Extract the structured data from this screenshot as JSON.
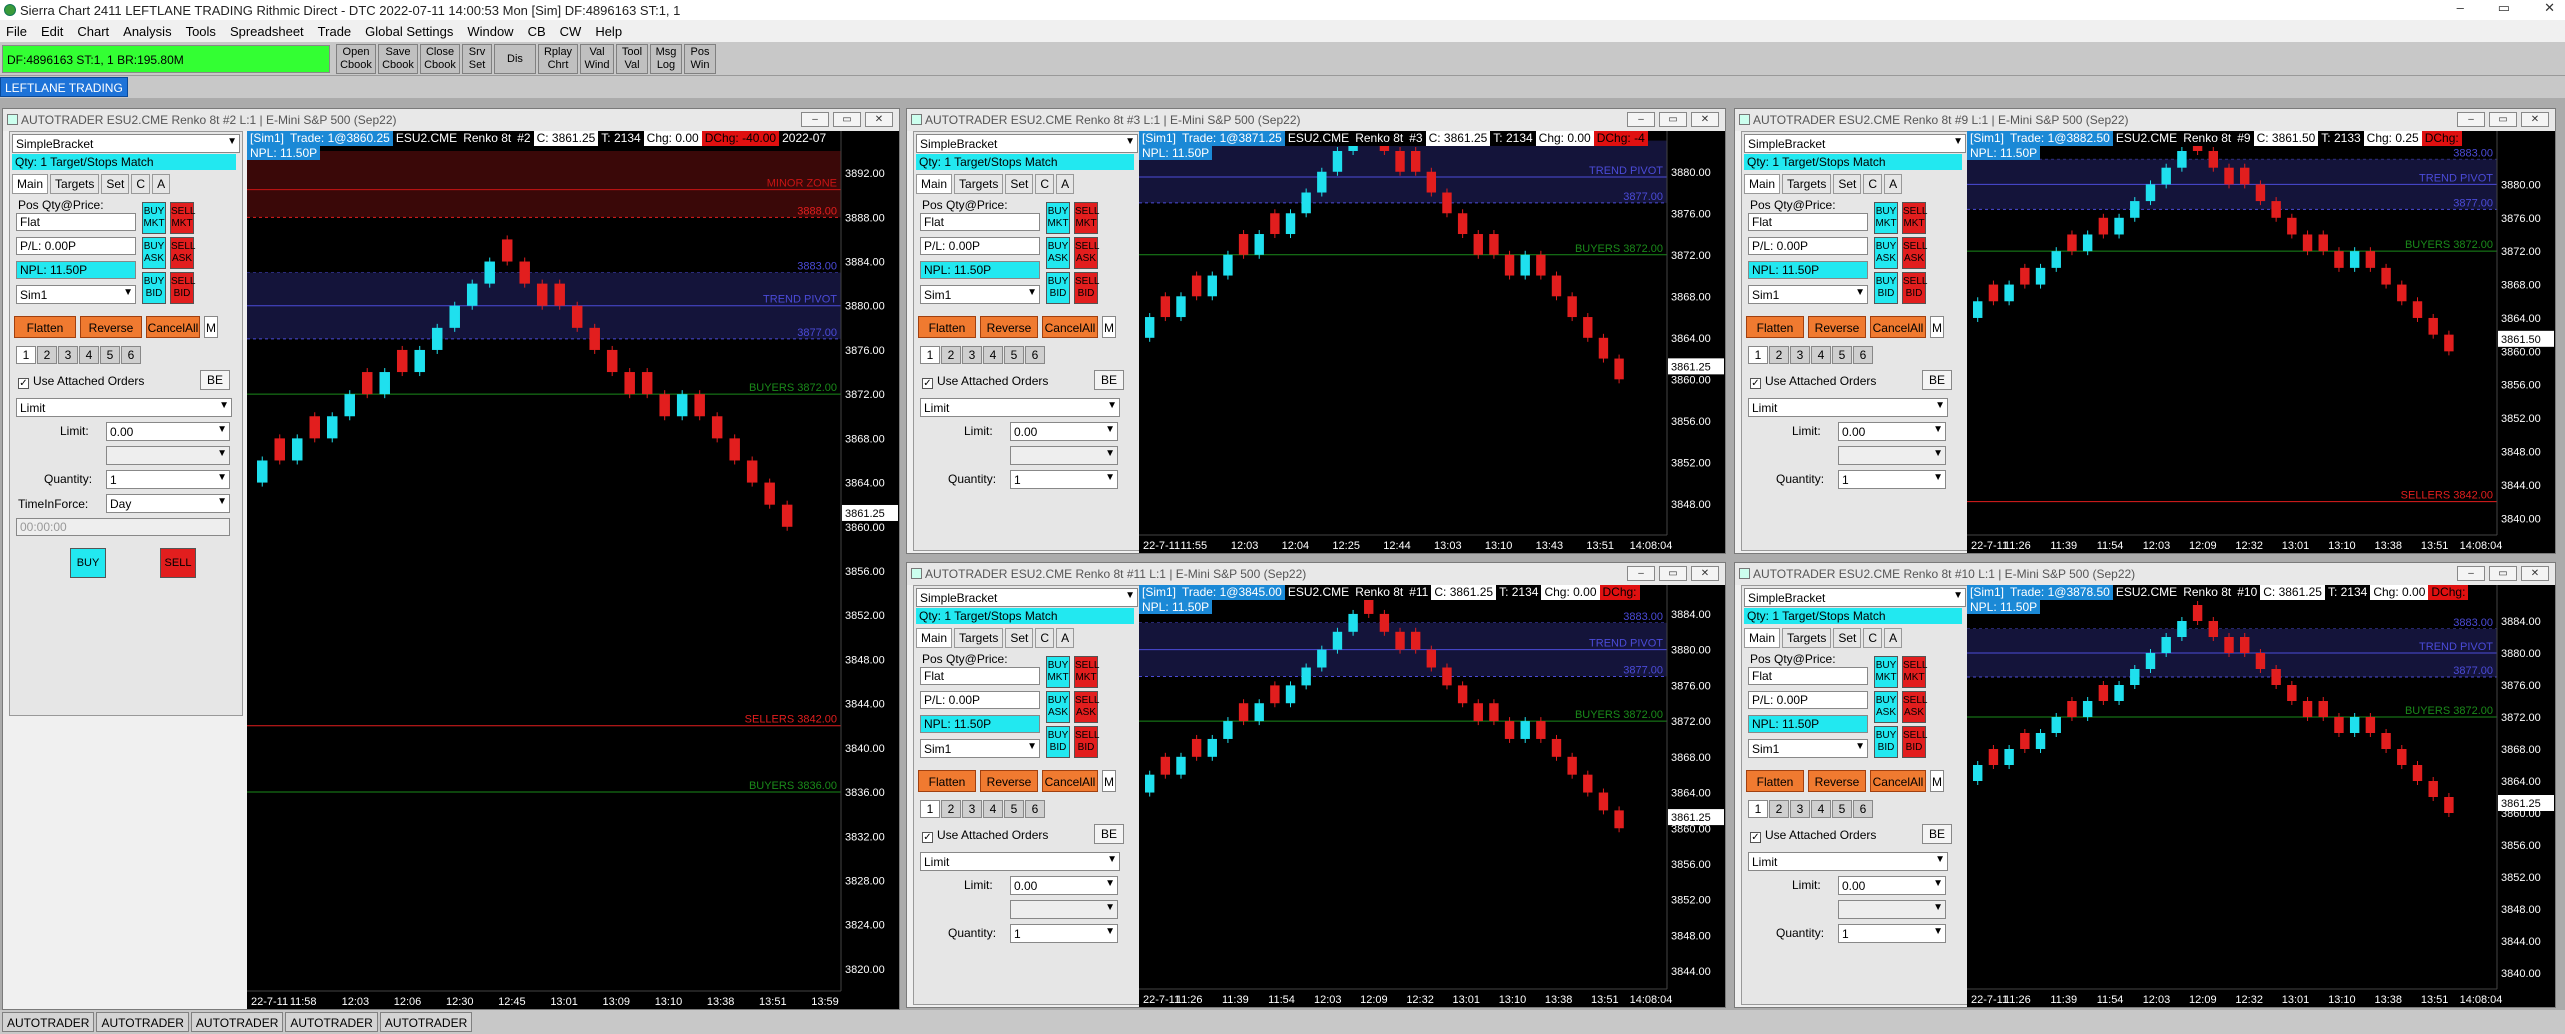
{
  "app": {
    "title": "Sierra Chart 2411 LEFTLANE TRADING  Rithmic Direct - DTC 2022-07-11  14:00:53 Mon [Sim]  DF:4896163  ST:1, 1",
    "window_controls": [
      "–",
      "▭",
      "✕"
    ]
  },
  "menu": [
    "File",
    "Edit",
    "Chart",
    "Analysis",
    "Tools",
    "Spreadsheet",
    "Trade",
    "Global Settings",
    "Window",
    "CB",
    "CW",
    "Help"
  ],
  "toolbar": {
    "status": "DF:4896163  ST:1, 1   BR:195.80M",
    "buttons": [
      {
        "l1": "Open",
        "l2": "Cbook"
      },
      {
        "l1": "Save",
        "l2": "Cbook"
      },
      {
        "l1": "Close",
        "l2": "Cbook"
      },
      {
        "l1": "Srv",
        "l2": "Set"
      },
      {
        "l1": "Dis",
        "l2": ""
      },
      {
        "l1": "Rplay",
        "l2": "Chrt"
      },
      {
        "l1": "Val",
        "l2": "Wind"
      },
      {
        "l1": "Tool",
        "l2": "Val"
      },
      {
        "l1": "Msg",
        "l2": "Log"
      },
      {
        "l1": "Pos",
        "l2": "Win"
      }
    ]
  },
  "chartbook_tab": "LEFTLANE TRADING",
  "bottom_tabs": [
    "AUTOTRADER",
    "AUTOTRADER",
    "AUTOTRADER",
    "AUTOTRADER",
    "AUTOTRADER"
  ],
  "colors": {
    "up": "#1fe0ee",
    "down": "#e21e1e",
    "trend_pivot": "#4b4bd8",
    "buyers": "#1a8a1a",
    "sellers": "#e21e1e",
    "minor_zone": "#c81414"
  },
  "dom": {
    "strategy": "SimpleBracket",
    "qty_label": "Qty: 1 Target/Stops Match",
    "tabs": [
      "Main",
      "Targets",
      "Set",
      "C",
      "A"
    ],
    "pos_label": "Pos Qty@Price:",
    "pos_value": "Flat",
    "pl_value": "P/L: 0.00P",
    "npl_value": "NPL: 11.50P",
    "account": "Sim1",
    "buy_mkt": "BUY\nMKT",
    "sell_mkt": "SELL\nMKT",
    "buy_ask": "BUY\nASK",
    "sell_ask": "SELL\nASK",
    "buy_bid": "BUY\nBID",
    "sell_bid": "SELL\nBID",
    "flatten": "Flatten",
    "reverse": "Reverse",
    "cancel_all": "CancelAll",
    "m": "M",
    "num_tabs": [
      "1",
      "2",
      "3",
      "4",
      "5",
      "6"
    ],
    "use_attached": "Use Attached Orders",
    "be": "BE",
    "order_type": "Limit",
    "limit_label": "Limit:",
    "limit_value": "0.00",
    "quantity_label": "Quantity:",
    "quantity_value": "1",
    "tif_label": "TimeInForce:",
    "tif_value": "Day",
    "time_value": "00:00:00",
    "buy": "BUY",
    "sell": "SELL"
  },
  "windows": [
    {
      "id": "w2",
      "title": "AUTOTRADER ESU2.CME  Renko 8t  #2 L:1 | E-Mini S&P 500 (Sep22)",
      "info": {
        "sim": "[Sim1]",
        "trade": "Trade: 1@3860.25",
        "symbol": "ESU2.CME",
        "bars": "Renko 8t",
        "num": "#2",
        "close": "C: 3861.25",
        "ticks": "T: 2134",
        "chg": "Chg: 0.00",
        "dchg": "DChg: -40.00",
        "date": "2022-07"
      },
      "npl": "NPL: 11.50P",
      "ylim": [
        3818,
        3894
      ],
      "yticks": [
        "3892.00",
        "3888.00",
        "3884.00",
        "3880.00",
        "3876.00",
        "3872.00",
        "3868.00",
        "3864.00",
        "3860.00",
        "3856.00",
        "3852.00",
        "3848.00",
        "3844.00",
        "3840.00",
        "3836.00",
        "3832.00",
        "3828.00",
        "3824.00",
        "3820.00"
      ],
      "price": "3861.25",
      "xlabels": [
        "22-7-11",
        "11:58",
        "12:03",
        "12:06",
        "12:30",
        "12:45",
        "13:01",
        "13:09",
        "13:10",
        "13:38",
        "13:51",
        "13:59"
      ],
      "levels": [
        {
          "label": "MINOR ZONE",
          "price": 3890.5,
          "color": "#c81414",
          "dash": false
        },
        {
          "label": "3888.00",
          "price": 3888,
          "color": "#e21e1e",
          "dash": true
        },
        {
          "label": "3883.00",
          "price": 3883,
          "color": "#4b4bd8",
          "dash": true
        },
        {
          "label": "TREND PIVOT",
          "price": 3880,
          "color": "#4b4bd8",
          "dash": false
        },
        {
          "label": "3877.00",
          "price": 3877,
          "color": "#4b4bd8",
          "dash": true
        },
        {
          "label": "BUYERS  3872.00",
          "price": 3872,
          "color": "#1a8a1a",
          "dash": false
        },
        {
          "label": "SELLERS  3842.00",
          "price": 3842,
          "color": "#e21e1e",
          "dash": false
        },
        {
          "label": "BUYERS  3836.00",
          "price": 3836,
          "color": "#1a8a1a",
          "dash": false
        }
      ],
      "full_panel": true
    },
    {
      "id": "w3",
      "title": "AUTOTRADER ESU2.CME  Renko 8t  #3 L:1 | E-Mini S&P 500 (Sep22)",
      "info": {
        "sim": "[Sim1]",
        "trade": "Trade: 1@3871.25",
        "symbol": "ESU2.CME",
        "bars": "Renko 8t",
        "num": "#3",
        "close": "C: 3861.25",
        "ticks": "T: 2134",
        "chg": "Chg: 0.00",
        "dchg": "DChg: -4",
        "date": ""
      },
      "npl": "NPL: 11.50P",
      "ylim": [
        3845,
        3882
      ],
      "yticks": [
        "3880.00",
        "3876.00",
        "3872.00",
        "3868.00",
        "3864.00",
        "3860.00",
        "3856.00",
        "3852.00",
        "3848.00"
      ],
      "price": "3861.25",
      "xlabels": [
        "22-7-11",
        "11:55",
        "12:03",
        "12:04",
        "12:25",
        "12:44",
        "13:03",
        "13:10",
        "13:43",
        "13:51",
        "14:08:04"
      ],
      "levels": [
        {
          "label": "TREND PIVOT",
          "price": 3879.5,
          "color": "#4b4bd8",
          "dash": false
        },
        {
          "label": "3877.00",
          "price": 3877,
          "color": "#4b4bd8",
          "dash": true
        },
        {
          "label": "BUYERS  3872.00",
          "price": 3872,
          "color": "#1a8a1a",
          "dash": false
        }
      ],
      "full_panel": false
    },
    {
      "id": "w9",
      "title": "AUTOTRADER ESU2.CME  Renko 8t  #9 L:1 | E-Mini S&P 500 (Sep22)",
      "info": {
        "sim": "[Sim1]",
        "trade": "Trade: 1@3882.50",
        "symbol": "ESU2.CME",
        "bars": "Renko 8t",
        "num": "#9",
        "close": "C: 3861.50",
        "ticks": "T: 2133",
        "chg": "Chg: 0.25",
        "dchg": "DChg:",
        "date": ""
      },
      "npl": "NPL: 11.50P",
      "ylim": [
        3838,
        3884
      ],
      "yticks": [
        "3880.00",
        "3876.00",
        "3872.00",
        "3868.00",
        "3864.00",
        "3860.00",
        "3856.00",
        "3852.00",
        "3848.00",
        "3844.00",
        "3840.00"
      ],
      "price": "3861.50",
      "xlabels": [
        "22-7-11",
        "11:26",
        "11:39",
        "11:54",
        "12:03",
        "12:09",
        "12:32",
        "13:01",
        "13:10",
        "13:38",
        "13:51",
        "14:08:04"
      ],
      "levels": [
        {
          "label": "3883.00",
          "price": 3883,
          "color": "#4b4bd8",
          "dash": true
        },
        {
          "label": "TREND PIVOT",
          "price": 3880,
          "color": "#4b4bd8",
          "dash": false
        },
        {
          "label": "3877.00",
          "price": 3877,
          "color": "#4b4bd8",
          "dash": true
        },
        {
          "label": "BUYERS  3872.00",
          "price": 3872,
          "color": "#1a8a1a",
          "dash": false
        },
        {
          "label": "SELLERS  3842.00",
          "price": 3842,
          "color": "#e21e1e",
          "dash": false
        }
      ],
      "full_panel": false
    },
    {
      "id": "w11",
      "title": "AUTOTRADER ESU2.CME  Renko 8t  #11 L:1 | E-Mini S&P 500 (Sep22)",
      "info": {
        "sim": "[Sim1]",
        "trade": "Trade: 1@3845.00",
        "symbol": "ESU2.CME",
        "bars": "Renko 8t",
        "num": "#11",
        "close": "C: 3861.25",
        "ticks": "T: 2134",
        "chg": "Chg: 0.00",
        "dchg": "DChg:",
        "date": ""
      },
      "npl": "NPL: 11.50P",
      "ylim": [
        3842,
        3885
      ],
      "yticks": [
        "3884.00",
        "3880.00",
        "3876.00",
        "3872.00",
        "3868.00",
        "3864.00",
        "3860.00",
        "3856.00",
        "3852.00",
        "3848.00",
        "3844.00"
      ],
      "price": "3861.25",
      "xlabels": [
        "22-7-11",
        "11:26",
        "11:39",
        "11:54",
        "12:03",
        "12:09",
        "12:32",
        "13:01",
        "13:10",
        "13:38",
        "13:51",
        "14:08:04"
      ],
      "levels": [
        {
          "label": "3883.00",
          "price": 3883,
          "color": "#4b4bd8",
          "dash": true
        },
        {
          "label": "TREND PIVOT",
          "price": 3880,
          "color": "#4b4bd8",
          "dash": false
        },
        {
          "label": "3877.00",
          "price": 3877,
          "color": "#4b4bd8",
          "dash": true
        },
        {
          "label": "BUYERS  3872.00",
          "price": 3872,
          "color": "#1a8a1a",
          "dash": false
        }
      ],
      "full_panel": false
    },
    {
      "id": "w10",
      "title": "AUTOTRADER ESU2.CME  Renko 8t  #10 L:1 | E-Mini S&P 500 (Sep22)",
      "info": {
        "sim": "[Sim1]",
        "trade": "Trade: 1@3878.50",
        "symbol": "ESU2.CME",
        "bars": "Renko 8t",
        "num": "#10",
        "close": "C: 3861.25",
        "ticks": "T: 2134",
        "chg": "Chg: 0.00",
        "dchg": "DChg:",
        "date": ""
      },
      "npl": "NPL: 11.50P",
      "ylim": [
        3838,
        3886
      ],
      "yticks": [
        "3884.00",
        "3880.00",
        "3876.00",
        "3872.00",
        "3868.00",
        "3864.00",
        "3860.00",
        "3856.00",
        "3852.00",
        "3848.00",
        "3844.00",
        "3840.00"
      ],
      "price": "3861.25",
      "xlabels": [
        "22-7-11",
        "11:26",
        "11:39",
        "11:54",
        "12:03",
        "12:09",
        "12:32",
        "13:01",
        "13:10",
        "13:38",
        "13:51",
        "14:08:04"
      ],
      "levels": [
        {
          "label": "3883.00",
          "price": 3883,
          "color": "#4b4bd8",
          "dash": true
        },
        {
          "label": "TREND PIVOT",
          "price": 3880,
          "color": "#4b4bd8",
          "dash": false
        },
        {
          "label": "3877.00",
          "price": 3877,
          "color": "#4b4bd8",
          "dash": true
        },
        {
          "label": "BUYERS  3872.00",
          "price": 3872,
          "color": "#1a8a1a",
          "dash": false
        }
      ],
      "full_panel": false
    }
  ],
  "chart_data": {
    "type": "renko",
    "symbol": "ESU2.CME",
    "brick_size_ticks": 8,
    "brick_points": 2,
    "bricks": [
      3866,
      3866,
      3868,
      3868,
      3870,
      3872,
      3872,
      3874,
      3874,
      3876,
      3878,
      3880,
      3882,
      3884,
      3884,
      3882,
      3880,
      3880,
      3878,
      3876,
      3874,
      3872,
      3872,
      3870,
      3872,
      3870,
      3868,
      3866,
      3864,
      3862,
      3860
    ],
    "last_price": 3861.25
  }
}
